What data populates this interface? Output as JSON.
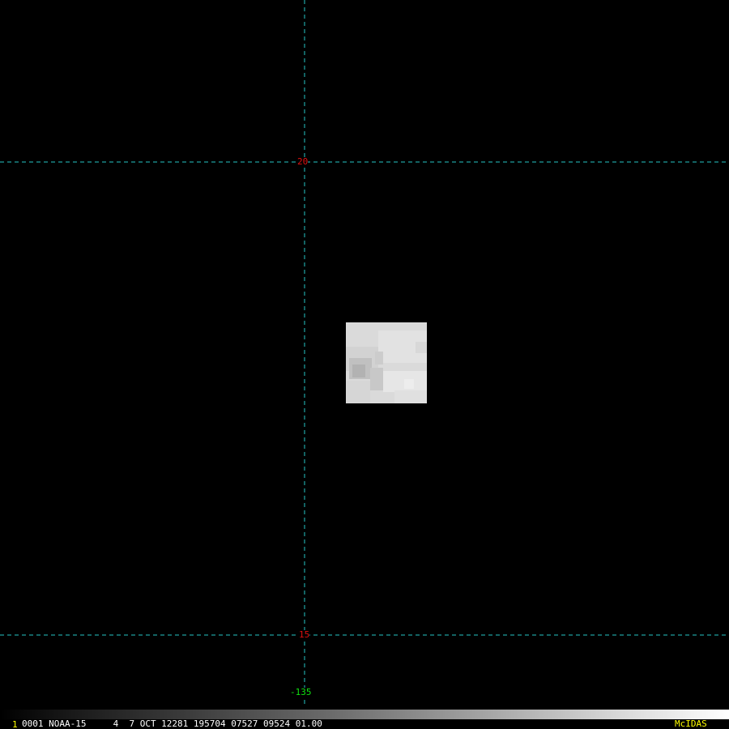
{
  "grid": {
    "line_color": "#26c6c6",
    "latitude_lines": [
      {
        "value": 20,
        "label": "20",
        "label_color": "#e01010"
      },
      {
        "value": 15,
        "label": "15",
        "label_color": "#e01010"
      }
    ],
    "longitude_lines": [
      {
        "value": -135,
        "label": "-135",
        "label_color": "#10e010"
      }
    ]
  },
  "image_patch": {
    "description_colors": {
      "base": "#dcdcdc",
      "light": "#e8e8e8",
      "mid": "#cfcfcf",
      "dark": "#b4b4b4"
    }
  },
  "status_bar": {
    "frame_number": "1",
    "frame_number_color": "#ffff00",
    "line": "0001 NOAA-15     4  7 OCT 12281 195704 07527 09524 01.00",
    "line_color": "#ffffff",
    "brand": "McIDAS",
    "brand_color": "#ffff00"
  }
}
